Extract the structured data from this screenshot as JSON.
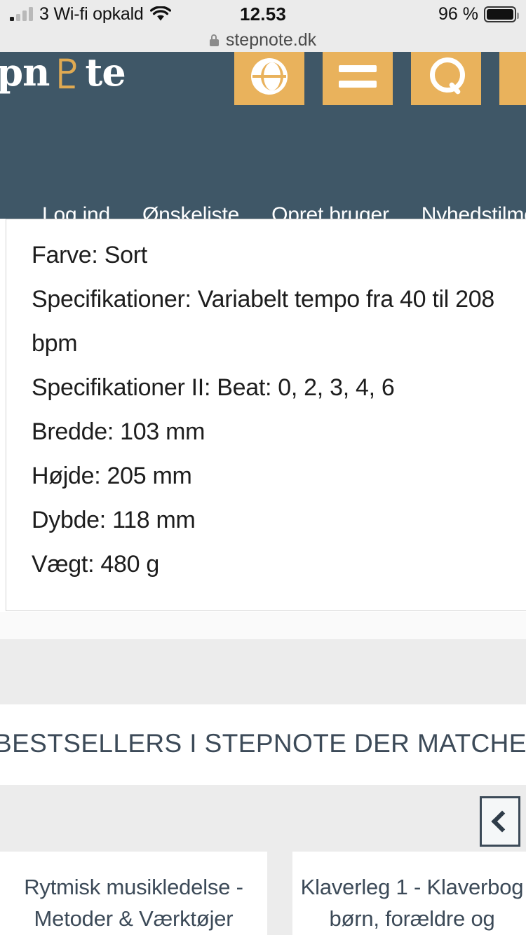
{
  "status_bar": {
    "carrier": "3 Wi-fi opkald",
    "signal_icon": "cellular-bars-icon",
    "wifi_icon": "wifi-icon",
    "time": "12.53",
    "battery_percent": "96 %",
    "battery_icon": "battery-full-icon"
  },
  "browser": {
    "lock_icon": "lock-icon",
    "url": "stepnote.dk"
  },
  "site_header": {
    "background_color": "#3f5767",
    "accent_color": "#e9b25c",
    "logo_text": "epn",
    "logo_clef": "♇",
    "logo_suffix": "te",
    "icon_buttons": [
      {
        "name": "language-globe-button",
        "icon": "globe-icon"
      },
      {
        "name": "menu-button",
        "icon": "hamburger-menu-icon"
      },
      {
        "name": "search-button",
        "icon": "search-icon"
      },
      {
        "name": "cart-button",
        "icon": "partial-icon"
      }
    ],
    "nav_links": [
      {
        "label": "Log ind"
      },
      {
        "label": "Ønskeliste"
      },
      {
        "label": "Opret bruger"
      },
      {
        "label": "Nyhedstilmelding"
      }
    ]
  },
  "specs": {
    "lines": [
      "Farve: Sort",
      "Specifikationer: Variabelt tempo fra 40 til 208 bpm",
      "Specifikationer II: Beat: 0, 2, 3, 4, 6",
      "Bredde: 103 mm",
      "Højde: 205 mm",
      "Dybde: 118 mm",
      "Vægt: 480 g"
    ]
  },
  "bestsellers": {
    "heading": "BESTSELLERS I STEPNOTE DER MATCHER DIN PRODU",
    "prev_button_icon": "chevron-left-icon",
    "cards": [
      {
        "title": "Rytmisk musikledelse - Metoder & Værktøjer"
      },
      {
        "title": "Klaverleg 1 - Klaverbog"
      },
      {
        "title": "børn, forældre og"
      }
    ]
  }
}
